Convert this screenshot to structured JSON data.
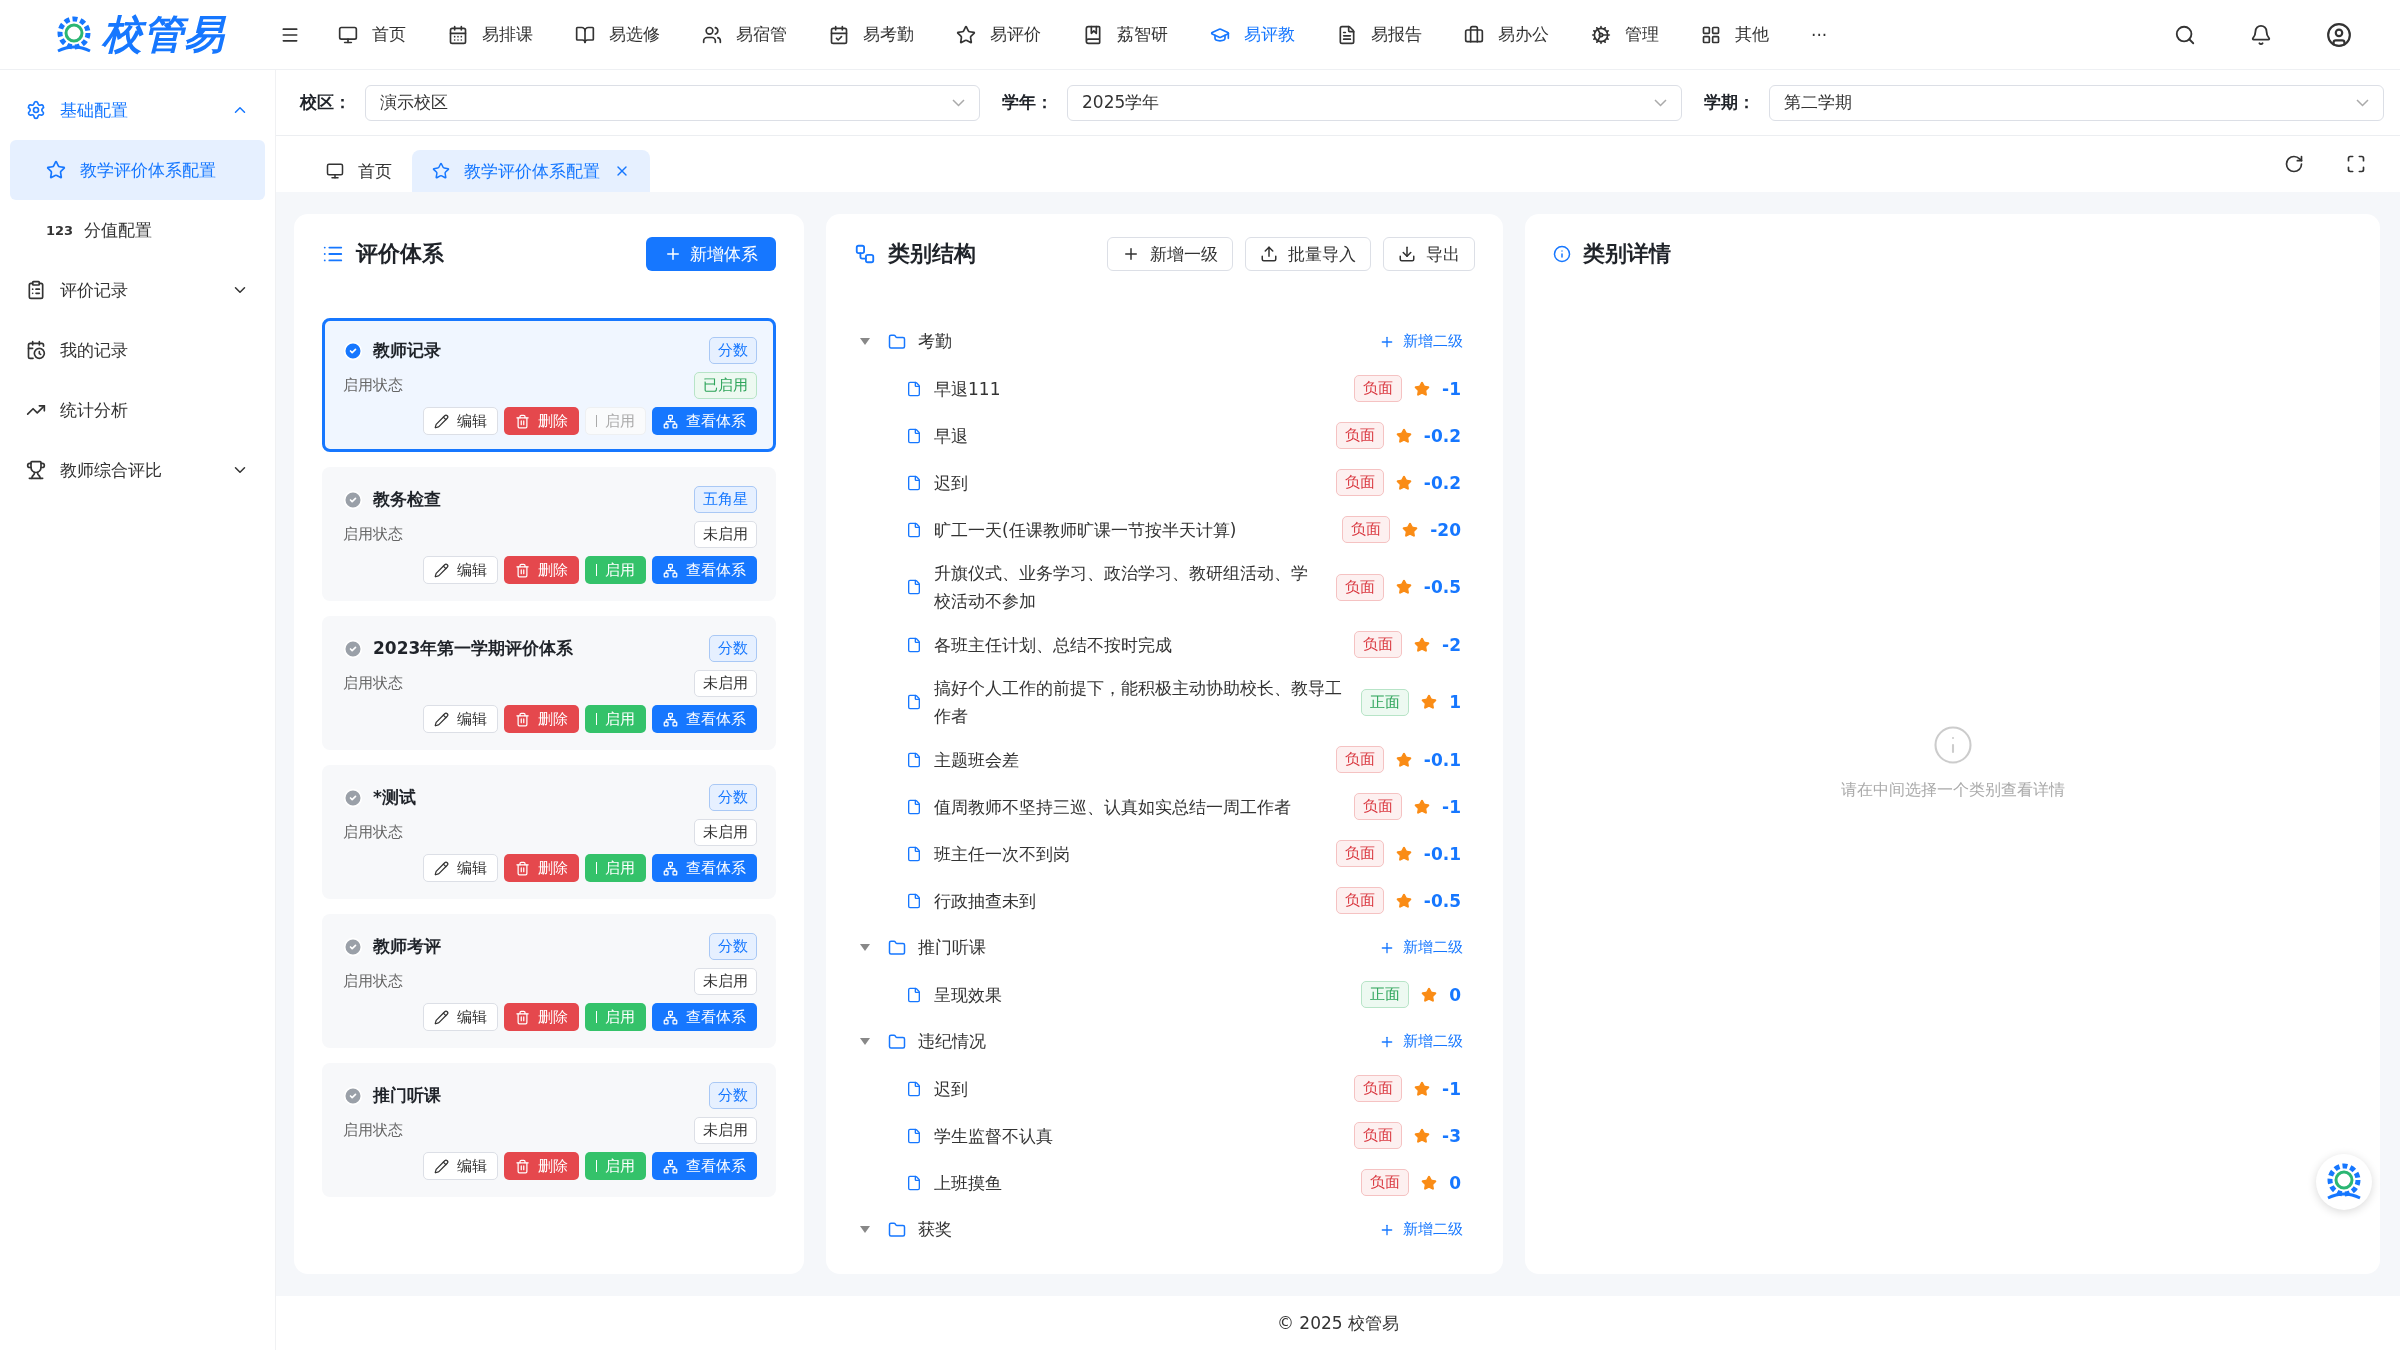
{
  "logo": {
    "text": "校管易"
  },
  "nav": [
    {
      "label": "首页",
      "selected": false
    },
    {
      "label": "易排课",
      "selected": false
    },
    {
      "label": "易选修",
      "selected": false
    },
    {
      "label": "易宿管",
      "selected": false
    },
    {
      "label": "易考勤",
      "selected": false
    },
    {
      "label": "易评价",
      "selected": false
    },
    {
      "label": "荔智研",
      "selected": false
    },
    {
      "label": "易评教",
      "selected": true
    },
    {
      "label": "易报告",
      "selected": false
    },
    {
      "label": "易办公",
      "selected": false
    },
    {
      "label": "管理",
      "selected": false
    },
    {
      "label": "其他",
      "selected": false
    }
  ],
  "nav_more": "···",
  "sidebar": [
    {
      "label": "基础配置",
      "kind": "group",
      "expanded": true,
      "children": [
        {
          "label": "教学评价体系配置",
          "selected": true
        },
        {
          "label": "分值配置",
          "selected": false,
          "icon_text": "123"
        }
      ]
    },
    {
      "label": "评价记录",
      "kind": "group",
      "expanded": false
    },
    {
      "label": "我的记录",
      "kind": "link"
    },
    {
      "label": "统计分析",
      "kind": "link"
    },
    {
      "label": "教师综合评比",
      "kind": "group",
      "expanded": false
    }
  ],
  "filters": [
    {
      "label": "校区：",
      "value": "演示校区"
    },
    {
      "label": "学年：",
      "value": "2025学年"
    },
    {
      "label": "学期：",
      "value": "第二学期"
    }
  ],
  "tabs": [
    {
      "label": "首页",
      "selected": false,
      "closable": false
    },
    {
      "label": "教学评价体系配置",
      "selected": true,
      "closable": true
    }
  ],
  "systems_panel": {
    "title": "评价体系",
    "add_button": "新增体系",
    "cards": [
      {
        "name": "教师记录",
        "selected": true,
        "type_tag": "分数",
        "status_label": "启用状态",
        "enabled": true,
        "status": "已启用",
        "edit": "编辑",
        "delete": "删除",
        "enable": "启用",
        "view": "查看体系"
      },
      {
        "name": "教务检查",
        "selected": false,
        "type_tag": "五角星",
        "status_label": "启用状态",
        "enabled": false,
        "status": "未启用",
        "edit": "编辑",
        "delete": "删除",
        "enable": "启用",
        "view": "查看体系"
      },
      {
        "name": "2023年第一学期评价体系",
        "selected": false,
        "type_tag": "分数",
        "status_label": "启用状态",
        "enabled": false,
        "status": "未启用",
        "edit": "编辑",
        "delete": "删除",
        "enable": "启用",
        "view": "查看体系"
      },
      {
        "name": "*测试",
        "selected": false,
        "type_tag": "分数",
        "status_label": "启用状态",
        "enabled": false,
        "status": "未启用",
        "edit": "编辑",
        "delete": "删除",
        "enable": "启用",
        "view": "查看体系"
      },
      {
        "name": "教师考评",
        "selected": false,
        "type_tag": "分数",
        "status_label": "启用状态",
        "enabled": false,
        "status": "未启用",
        "edit": "编辑",
        "delete": "删除",
        "enable": "启用",
        "view": "查看体系"
      },
      {
        "name": "推门听课",
        "selected": false,
        "type_tag": "分数",
        "status_label": "启用状态",
        "enabled": false,
        "status": "未启用",
        "edit": "编辑",
        "delete": "删除",
        "enable": "启用",
        "view": "查看体系"
      }
    ]
  },
  "category_panel": {
    "title": "类别结构",
    "buttons": [
      {
        "label": "新增一级",
        "kind": "add"
      },
      {
        "label": "批量导入",
        "kind": "import"
      },
      {
        "label": "导出",
        "kind": "export"
      }
    ],
    "tree": [
      {
        "name": "考勤",
        "expanded": true,
        "add_label": "新增二级",
        "children": [
          {
            "name": "早退111",
            "kind": "negative",
            "tag": "负面",
            "score": "-1"
          },
          {
            "name": "早退",
            "kind": "negative",
            "tag": "负面",
            "score": "-0.2"
          },
          {
            "name": "迟到",
            "kind": "negative",
            "tag": "负面",
            "score": "-0.2"
          },
          {
            "name": "旷工一天(任课教师旷课一节按半天计算)",
            "kind": "negative",
            "tag": "负面",
            "score": "-20"
          },
          {
            "name": "升旗仪式、业务学习、政治学习、教研组活动、学校活动不参加",
            "kind": "negative",
            "tag": "负面",
            "score": "-0.5"
          },
          {
            "name": "各班主任计划、总结不按时完成",
            "kind": "negative",
            "tag": "负面",
            "score": "-2"
          },
          {
            "name": "搞好个人工作的前提下，能积极主动协助校长、教导工作者",
            "kind": "positive",
            "tag": "正面",
            "score": "1"
          },
          {
            "name": "主题班会差",
            "kind": "negative",
            "tag": "负面",
            "score": "-0.1"
          },
          {
            "name": "值周教师不坚持三巡、认真如实总结一周工作者",
            "kind": "negative",
            "tag": "负面",
            "score": "-1"
          },
          {
            "name": "班主任一次不到岗",
            "kind": "negative",
            "tag": "负面",
            "score": "-0.1"
          },
          {
            "name": "行政抽查未到",
            "kind": "negative",
            "tag": "负面",
            "score": "-0.5"
          }
        ]
      },
      {
        "name": "推门听课",
        "expanded": true,
        "add_label": "新增二级",
        "children": [
          {
            "name": "呈现效果",
            "kind": "positive",
            "tag": "正面",
            "score": "0"
          }
        ]
      },
      {
        "name": "违纪情况",
        "expanded": true,
        "add_label": "新增二级",
        "children": [
          {
            "name": "迟到",
            "kind": "negative",
            "tag": "负面",
            "score": "-1"
          },
          {
            "name": "学生监督不认真",
            "kind": "negative",
            "tag": "负面",
            "score": "-3"
          },
          {
            "name": "上班摸鱼",
            "kind": "negative",
            "tag": "负面",
            "score": "0"
          }
        ]
      },
      {
        "name": "获奖",
        "expanded": true,
        "add_label": "新增二级"
      }
    ]
  },
  "detail_panel": {
    "title": "类别详情",
    "empty_text": "请在中间选择一个类别查看详情"
  },
  "footer": "© 2025 校管易"
}
